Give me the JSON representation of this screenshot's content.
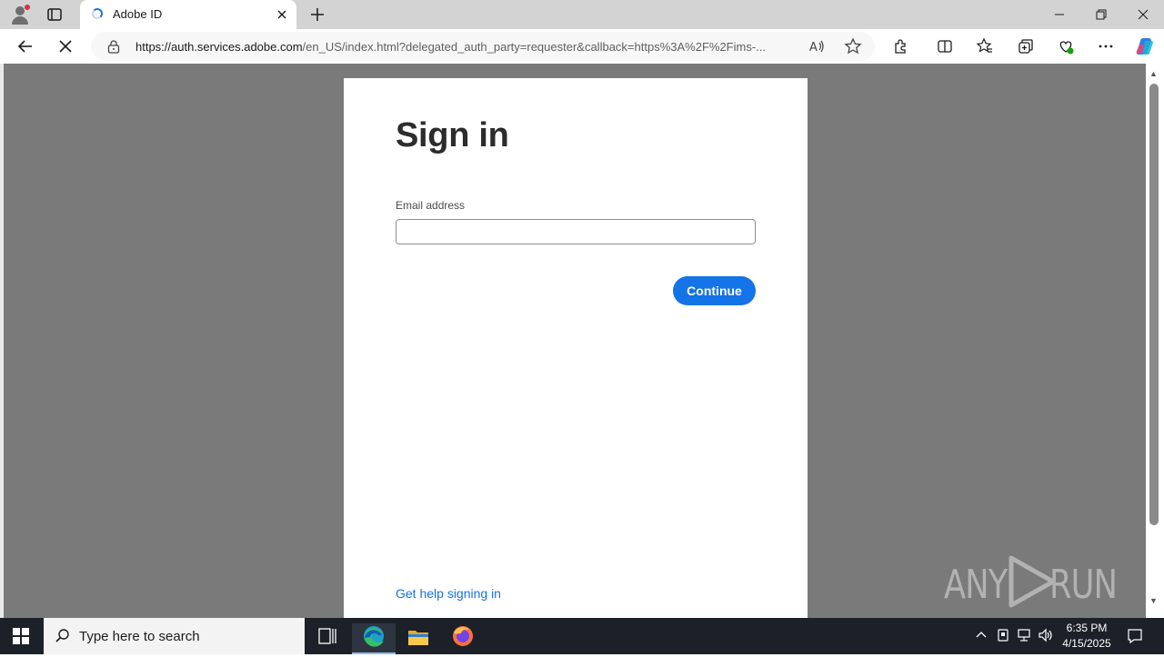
{
  "browser": {
    "tab": {
      "title": "Adobe ID"
    },
    "url": {
      "host": "https://auth.services.adobe.com",
      "path": "/en_US/index.html?delegated_auth_party=requester&callback=https%3A%2F%2Fims-..."
    }
  },
  "page": {
    "heading": "Sign in",
    "email_label": "Email address",
    "email_value": "",
    "continue_label": "Continue",
    "help_link": "Get help signing in"
  },
  "watermark": {
    "left": "ANY",
    "right": "RUN"
  },
  "taskbar": {
    "search_placeholder": "Type here to search",
    "time": "6:35 PM",
    "date": "4/15/2025"
  },
  "colors": {
    "accent": "#1473e6",
    "backdrop": "#7a7a7a",
    "taskbar": "#1c2028"
  }
}
